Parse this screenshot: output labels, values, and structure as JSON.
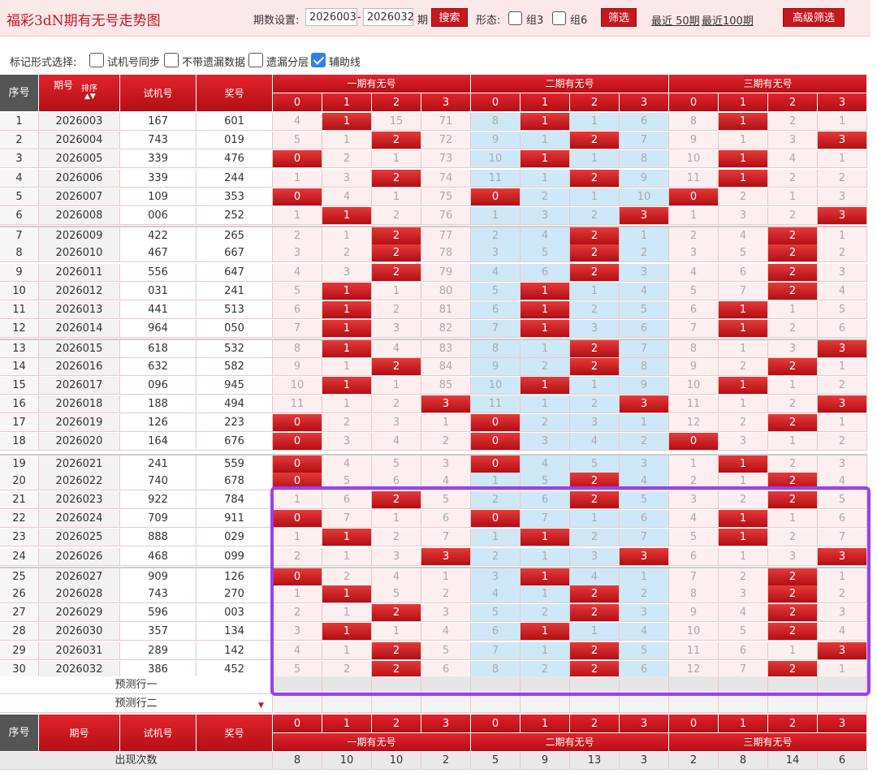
{
  "app_title": "福彩3dN期有无号走势图",
  "toolbar": {
    "period_label": "期数设置:",
    "from_value": "2026003",
    "dash": "-",
    "to_value": "2026032",
    "period_unit": "期",
    "search_label": "搜索",
    "shape_label": "形态:",
    "group3_label": "组3",
    "group6_label": "组6",
    "filter_label": "筛选",
    "recent50_label": "最近 50期",
    "recent100_label": "最近100期",
    "advanced_label": "高级筛选"
  },
  "mark_bar": {
    "label": "标记形式选择:",
    "options": [
      {
        "label": "试机号同步",
        "checked": false
      },
      {
        "label": "不带遗漏数据",
        "checked": false
      },
      {
        "label": "遗漏分层",
        "checked": false
      },
      {
        "label": "辅助线",
        "checked": true
      }
    ]
  },
  "table": {
    "headers": {
      "seq": "序号",
      "period": "期号",
      "sort": "排序",
      "trial": "试机号",
      "prize": "奖号",
      "groups": [
        "一期有无号",
        "二期有无号",
        "三期有无号"
      ],
      "digits": [
        "0",
        "1",
        "2",
        "3"
      ]
    },
    "rows": [
      {
        "seq": "1",
        "period": "2026003",
        "trial": "167",
        "prize": "601",
        "cells": [
          4,
          1,
          15,
          71,
          8,
          1,
          1,
          6,
          8,
          1,
          2,
          1
        ],
        "hits": [
          1,
          5,
          9
        ]
      },
      {
        "seq": "2",
        "period": "2026004",
        "trial": "743",
        "prize": "019",
        "cells": [
          5,
          1,
          2,
          72,
          9,
          1,
          2,
          7,
          9,
          1,
          3,
          3
        ],
        "hits": [
          2,
          6,
          11
        ]
      },
      {
        "seq": "3",
        "period": "2026005",
        "trial": "339",
        "prize": "476",
        "cells": [
          0,
          2,
          1,
          73,
          10,
          1,
          1,
          8,
          10,
          1,
          4,
          1
        ],
        "hits": [
          0,
          5,
          9
        ]
      },
      {
        "seq": "4",
        "period": "2026006",
        "trial": "339",
        "prize": "244",
        "cells": [
          1,
          3,
          2,
          74,
          11,
          1,
          2,
          9,
          11,
          1,
          2,
          2
        ],
        "hits": [
          2,
          6,
          9
        ]
      },
      {
        "seq": "5",
        "period": "2026007",
        "trial": "109",
        "prize": "353",
        "cells": [
          0,
          4,
          1,
          75,
          0,
          2,
          1,
          10,
          0,
          2,
          1,
          3
        ],
        "hits": [
          0,
          4,
          8
        ]
      },
      {
        "seq": "6",
        "period": "2026008",
        "trial": "006",
        "prize": "252",
        "cells": [
          1,
          1,
          2,
          76,
          1,
          3,
          2,
          3,
          1,
          3,
          2,
          3
        ],
        "hits": [
          1,
          7,
          11
        ]
      },
      {
        "seq": "7",
        "period": "2026009",
        "trial": "422",
        "prize": "265",
        "cells": [
          2,
          1,
          2,
          77,
          2,
          4,
          2,
          1,
          2,
          4,
          2,
          1
        ],
        "hits": [
          2,
          6,
          10
        ]
      },
      {
        "seq": "8",
        "period": "2026010",
        "trial": "467",
        "prize": "667",
        "cells": [
          3,
          2,
          2,
          78,
          3,
          5,
          2,
          2,
          3,
          5,
          2,
          2
        ],
        "hits": [
          2,
          6,
          10
        ]
      },
      {
        "seq": "9",
        "period": "2026011",
        "trial": "556",
        "prize": "647",
        "cells": [
          4,
          3,
          2,
          79,
          4,
          6,
          2,
          3,
          4,
          6,
          2,
          3
        ],
        "hits": [
          2,
          6,
          10
        ]
      },
      {
        "seq": "10",
        "period": "2026012",
        "trial": "031",
        "prize": "241",
        "cells": [
          5,
          1,
          1,
          80,
          5,
          1,
          1,
          4,
          5,
          7,
          2,
          4
        ],
        "hits": [
          1,
          5,
          10
        ]
      },
      {
        "seq": "11",
        "period": "2026013",
        "trial": "441",
        "prize": "513",
        "cells": [
          6,
          1,
          2,
          81,
          6,
          1,
          2,
          5,
          6,
          1,
          1,
          5
        ],
        "hits": [
          1,
          5,
          9
        ]
      },
      {
        "seq": "12",
        "period": "2026014",
        "trial": "964",
        "prize": "050",
        "cells": [
          7,
          1,
          3,
          82,
          7,
          1,
          3,
          6,
          7,
          1,
          2,
          6
        ],
        "hits": [
          1,
          5,
          9
        ]
      },
      {
        "seq": "13",
        "period": "2026015",
        "trial": "618",
        "prize": "532",
        "cells": [
          8,
          1,
          4,
          83,
          8,
          1,
          2,
          7,
          8,
          1,
          3,
          3
        ],
        "hits": [
          1,
          6,
          11
        ]
      },
      {
        "seq": "14",
        "period": "2026016",
        "trial": "632",
        "prize": "582",
        "cells": [
          9,
          1,
          2,
          84,
          9,
          2,
          2,
          8,
          9,
          2,
          2,
          1
        ],
        "hits": [
          2,
          6,
          10
        ]
      },
      {
        "seq": "15",
        "period": "2026017",
        "trial": "096",
        "prize": "945",
        "cells": [
          10,
          1,
          1,
          85,
          10,
          1,
          1,
          9,
          10,
          1,
          1,
          2
        ],
        "hits": [
          1,
          5,
          9
        ]
      },
      {
        "seq": "16",
        "period": "2026018",
        "trial": "188",
        "prize": "494",
        "cells": [
          11,
          1,
          2,
          3,
          11,
          1,
          2,
          3,
          11,
          1,
          2,
          3
        ],
        "hits": [
          3,
          7,
          11
        ]
      },
      {
        "seq": "17",
        "period": "2026019",
        "trial": "126",
        "prize": "223",
        "cells": [
          0,
          2,
          3,
          1,
          0,
          2,
          3,
          1,
          12,
          2,
          2,
          1
        ],
        "hits": [
          0,
          4,
          10
        ]
      },
      {
        "seq": "18",
        "period": "2026020",
        "trial": "164",
        "prize": "676",
        "cells": [
          0,
          3,
          4,
          2,
          0,
          3,
          4,
          2,
          0,
          3,
          1,
          2
        ],
        "hits": [
          0,
          4,
          8
        ]
      },
      {
        "seq": "19",
        "period": "2026021",
        "trial": "241",
        "prize": "559",
        "cells": [
          0,
          4,
          5,
          3,
          0,
          4,
          5,
          3,
          1,
          1,
          2,
          3
        ],
        "hits": [
          0,
          4,
          9
        ]
      },
      {
        "seq": "20",
        "period": "2026022",
        "trial": "740",
        "prize": "678",
        "cells": [
          0,
          5,
          6,
          4,
          1,
          5,
          2,
          4,
          2,
          1,
          2,
          4
        ],
        "hits": [
          0,
          6,
          10
        ]
      },
      {
        "seq": "21",
        "period": "2026023",
        "trial": "922",
        "prize": "784",
        "cells": [
          1,
          6,
          2,
          5,
          2,
          6,
          2,
          5,
          3,
          2,
          2,
          5
        ],
        "hits": [
          2,
          6,
          10
        ]
      },
      {
        "seq": "22",
        "period": "2026024",
        "trial": "709",
        "prize": "911",
        "cells": [
          0,
          7,
          1,
          6,
          0,
          7,
          1,
          6,
          4,
          1,
          1,
          6
        ],
        "hits": [
          0,
          4,
          9
        ]
      },
      {
        "seq": "23",
        "period": "2026025",
        "trial": "888",
        "prize": "029",
        "cells": [
          1,
          1,
          2,
          7,
          1,
          1,
          2,
          7,
          5,
          1,
          2,
          7
        ],
        "hits": [
          1,
          5,
          9
        ]
      },
      {
        "seq": "24",
        "period": "2026026",
        "trial": "468",
        "prize": "099",
        "cells": [
          2,
          1,
          3,
          3,
          2,
          1,
          3,
          3,
          6,
          1,
          3,
          3
        ],
        "hits": [
          3,
          7,
          11
        ]
      },
      {
        "seq": "25",
        "period": "2026027",
        "trial": "909",
        "prize": "126",
        "cells": [
          0,
          2,
          4,
          1,
          3,
          1,
          4,
          1,
          7,
          2,
          2,
          1
        ],
        "hits": [
          0,
          5,
          10
        ]
      },
      {
        "seq": "26",
        "period": "2026028",
        "trial": "743",
        "prize": "270",
        "cells": [
          1,
          1,
          5,
          2,
          4,
          1,
          2,
          2,
          8,
          3,
          2,
          2
        ],
        "hits": [
          1,
          6,
          10
        ]
      },
      {
        "seq": "27",
        "period": "2026029",
        "trial": "596",
        "prize": "003",
        "cells": [
          2,
          1,
          2,
          3,
          5,
          2,
          2,
          3,
          9,
          4,
          2,
          3
        ],
        "hits": [
          2,
          6,
          10
        ]
      },
      {
        "seq": "28",
        "period": "2026030",
        "trial": "357",
        "prize": "134",
        "cells": [
          3,
          1,
          1,
          4,
          6,
          1,
          1,
          4,
          10,
          5,
          2,
          4
        ],
        "hits": [
          1,
          5,
          10
        ]
      },
      {
        "seq": "29",
        "period": "2026031",
        "trial": "289",
        "prize": "142",
        "cells": [
          4,
          1,
          2,
          5,
          7,
          1,
          2,
          5,
          11,
          6,
          1,
          3
        ],
        "hits": [
          2,
          6,
          11
        ]
      },
      {
        "seq": "30",
        "period": "2026032",
        "trial": "386",
        "prize": "452",
        "cells": [
          5,
          2,
          2,
          6,
          8,
          2,
          2,
          6,
          12,
          7,
          2,
          1
        ],
        "hits": [
          2,
          6,
          10
        ]
      }
    ],
    "predict1": "预测行一",
    "predict2": "预测行二",
    "count_label": "出现次数",
    "counts": [
      8,
      10,
      10,
      2,
      5,
      9,
      13,
      3,
      2,
      8,
      14,
      6
    ]
  },
  "colors": {
    "brand_red": "#c8171f",
    "hit_red": "#d4151b",
    "pink": "#fdeff0",
    "light_blue": "#cfe8f7",
    "selection": "#9b3ff0"
  }
}
